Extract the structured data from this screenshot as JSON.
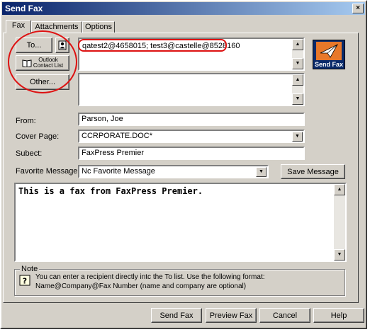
{
  "window": {
    "title": "Send Fax",
    "close_glyph": "×"
  },
  "tabs": [
    {
      "label": "Fax",
      "active": true
    },
    {
      "label": "Attachments",
      "active": false
    },
    {
      "label": "Options",
      "active": false
    }
  ],
  "recipients": {
    "to_button": "To...",
    "outlook_button_line1": "Outlook",
    "outlook_button_line2": "Contact List",
    "other_button": "Other...",
    "to_list_value": "qatest2@4658015; test3@castelle@8528160",
    "other_list_value": ""
  },
  "send_fax_icon_label": "Send Fax",
  "form": {
    "from_label": "From:",
    "from_value": "Parson, Joe",
    "cover_label": "Cover Page:",
    "cover_value": "CCRPORATE.DOC*",
    "subject_label": "Subect:",
    "subject_value": "FaxPress Premier",
    "favorite_label": "Favorite Message",
    "favorite_value": "Nc Favorite Message",
    "save_message_button": "Save Message"
  },
  "message_body": "This is a fax from FaxPress Premier.",
  "note": {
    "title": "Note",
    "line1": "You can enter a recipient directly intc the To list. Use the following format:",
    "line2": "Name@Company@Fax Number  (name and company are optional)"
  },
  "footer": {
    "send_fax": "Send Fax",
    "preview_fax": "Preview Fax",
    "cancel": "Cancel",
    "help": "Help"
  },
  "colors": {
    "title_start": "#0a246a",
    "title_end": "#a6caf0",
    "annotation": "#dd1111",
    "face": "#d4d0c8"
  }
}
